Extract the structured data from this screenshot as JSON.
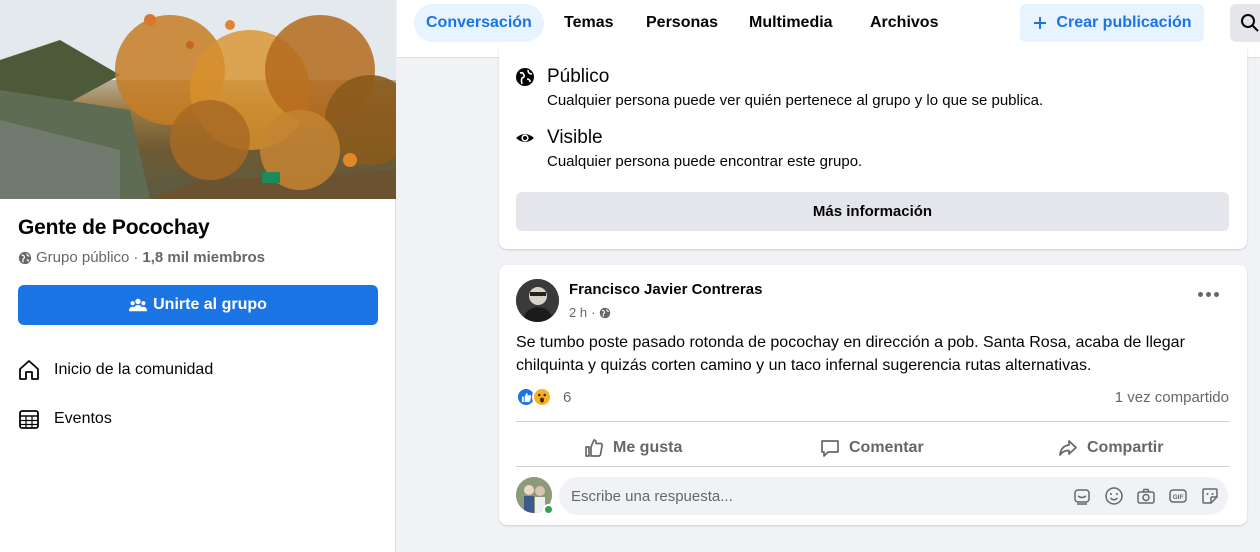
{
  "group": {
    "title": "Gente de Pocochay",
    "type": "Grupo público",
    "separator": "·",
    "members": "1,8 mil miembros",
    "join_label": "Unirte al grupo"
  },
  "sidebar": {
    "items": [
      {
        "label": "Inicio de la comunidad",
        "icon": "home-icon"
      },
      {
        "label": "Eventos",
        "icon": "calendar-icon"
      }
    ]
  },
  "tabs": [
    {
      "label": "Conversación",
      "active": true
    },
    {
      "label": "Temas",
      "active": false
    },
    {
      "label": "Personas",
      "active": false
    },
    {
      "label": "Multimedia",
      "active": false
    },
    {
      "label": "Archivos",
      "active": false
    }
  ],
  "toolbar": {
    "create_label": "Crear publicación",
    "create_icon": "plus-icon",
    "search_icon": "search-icon"
  },
  "about": {
    "privacy": [
      {
        "title": "Público",
        "desc": "Cualquier persona puede ver quién pertenece al grupo y lo que se publica.",
        "icon": "globe-icon"
      },
      {
        "title": "Visible",
        "desc": "Cualquier persona puede encontrar este grupo.",
        "icon": "eye-icon"
      }
    ],
    "more_label": "Más información"
  },
  "post": {
    "author": "Francisco Javier Contreras",
    "time": "2 h",
    "separator": "·",
    "text": "Se tumbo poste pasado rotonda de pocochay en dirección a pob. Santa Rosa, acaba de llegar chilquinta y quizás corten camino y un taco infernal sugerencia rutas alternativas.",
    "reaction_count": "6",
    "share_count": "1 vez compartido",
    "actions": {
      "like": "Me gusta",
      "comment": "Comentar",
      "share": "Compartir"
    },
    "reply_placeholder": "Escribe una respuesta..."
  },
  "colors": {
    "accent": "#1b74e4",
    "accent_light": "#e7f3ff",
    "muted": "#65676b",
    "online": "#31a24c"
  }
}
